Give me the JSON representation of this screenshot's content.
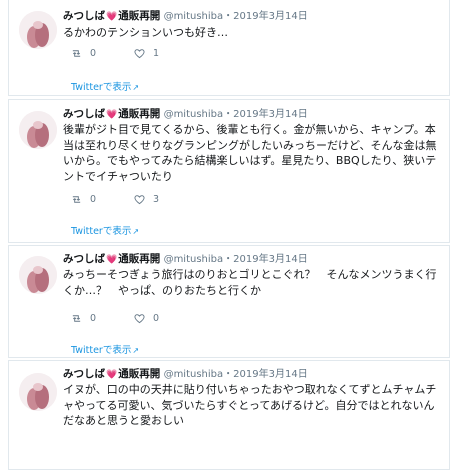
{
  "tweets": [
    {
      "name": "みつしば",
      "badge": "通販再開",
      "handle": "@mitushiba",
      "dot": "・",
      "date": "2019年3月14日",
      "text": "るかわのテンションいつも好き…",
      "retweets": "0",
      "likes": "1",
      "view_link": "Twitterで表示"
    },
    {
      "name": "みつしば",
      "badge": "通販再開",
      "handle": "@mitushiba",
      "dot": "・",
      "date": "2019年3月14日",
      "text": "後輩がジト目で見てくるから、後輩とも行く。金が無いから、キャンプ。本当は至れり尽くせりなグランピングがしたいみっちーだけど、そんな金は無いから。でもやってみたら結構楽しいはず。星見たり、BBQしたり、狭いテントでイチャついたり",
      "retweets": "0",
      "likes": "3",
      "view_link": "Twitterで表示"
    },
    {
      "name": "みつしば",
      "badge": "通販再開",
      "handle": "@mitushiba",
      "dot": "・",
      "date": "2019年3月14日",
      "text": "みっちーそつぎょう旅行はのりおとゴリとこぐれ？　そんなメンツうまく行くか…？　やっぱ、のりおたちと行くか",
      "retweets": "0",
      "likes": "0",
      "view_link": "Twitterで表示"
    },
    {
      "name": "みつしば",
      "badge": "通販再開",
      "handle": "@mitushiba",
      "dot": "・",
      "date": "2019年3月14日",
      "text": "イヌが、口の中の天井に貼り付いちゃったおやつ取れなくてずとムチャムチャやってる可愛い、気づいたらすぐとってあげるけど。自分ではとれないんだなあと思うと愛おしい"
    }
  ]
}
